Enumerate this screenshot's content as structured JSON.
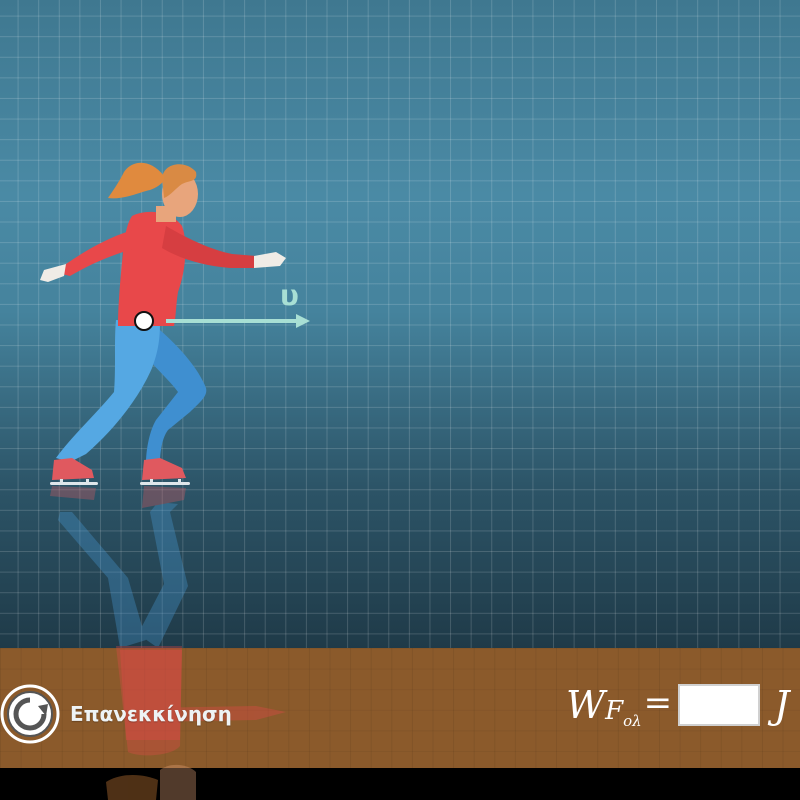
{
  "controls": {
    "restart_label": "Επανεκκίνηση"
  },
  "vector": {
    "label": "υ"
  },
  "formula": {
    "work_symbol": "W",
    "force_symbol": "F",
    "subscript": "ολ",
    "equals": "=",
    "answer_value": "",
    "unit": "J"
  },
  "colors": {
    "sky_top": "#3f7890",
    "floor": "#8b5a2b",
    "velocity_arrow": "#a8dfd4",
    "shirt": "#e8484a",
    "pants": "#4b9fdc",
    "hair": "#d98a44",
    "skin": "#e8a57c",
    "skate": "#e0595f"
  },
  "icons": {
    "restart": "restart-icon",
    "velocity": "velocity-arrow"
  }
}
